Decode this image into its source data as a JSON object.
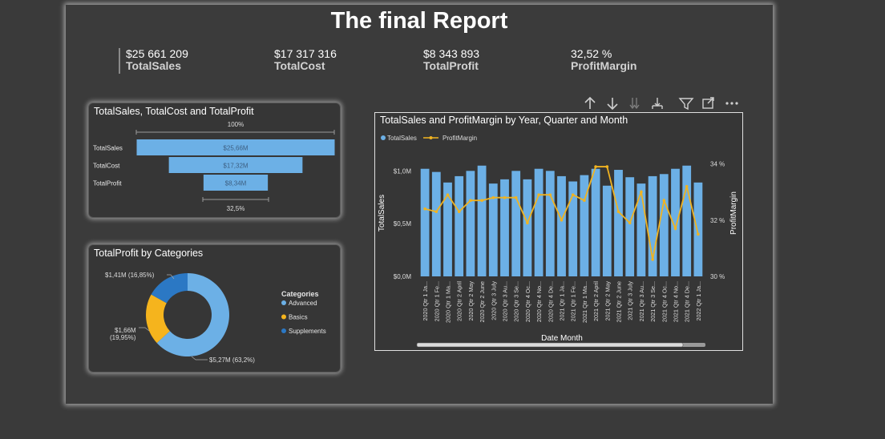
{
  "report": {
    "title": "The final Report"
  },
  "kpis": [
    {
      "value": "$25 661 209",
      "label": "TotalSales"
    },
    {
      "value": "$17 317 316",
      "label": "TotalCost"
    },
    {
      "value": "$8 343 893",
      "label": "TotalProfit"
    },
    {
      "value": "32,52 %",
      "label": "ProfitMargin"
    }
  ],
  "funnel": {
    "title": "TotalSales, TotalCost and TotalProfit",
    "top_label": "100%",
    "bottom_label": "32,5%",
    "rows": [
      {
        "label": "TotalSales",
        "value_label": "$25,66M"
      },
      {
        "label": "TotalCost",
        "value_label": "$17,32M"
      },
      {
        "label": "TotalProfit",
        "value_label": "$8,34M"
      }
    ]
  },
  "donut": {
    "title": "TotalProfit by Categories",
    "legend_title": "Categories",
    "slice_labels": [
      "$5,27M (63,2%)",
      "$1,66M",
      "(19,95%)",
      "$1,41M (16,85%)"
    ]
  },
  "combo": {
    "title": "TotalSales and ProfitMargin by Year, Quarter and Month",
    "x_title": "Date Month",
    "y_left_title": "TotalSales",
    "y_right_title": "ProfitMargin",
    "y_left_ticks": [
      "$1,0M",
      "$0,5M",
      "$0,0M"
    ],
    "y_right_ticks": [
      "34 %",
      "32 %",
      "30 %"
    ]
  },
  "colors": {
    "advanced": "#6cb0e6",
    "basics": "#f5b41d",
    "supplements": "#2b78c4",
    "line": "#f0b321"
  },
  "chart_data": [
    {
      "type": "bar",
      "title": "TotalSales, TotalCost and TotalProfit",
      "categories": [
        "TotalSales",
        "TotalCost",
        "TotalProfit"
      ],
      "values": [
        25.66,
        17.32,
        8.34
      ],
      "value_labels": [
        "$25,66M",
        "$17,32M",
        "$8,34M"
      ],
      "unit": "$M"
    },
    {
      "type": "pie",
      "title": "TotalProfit by Categories",
      "categories": [
        "Advanced",
        "Basics",
        "Supplements"
      ],
      "values": [
        5.27,
        1.66,
        1.41
      ],
      "percents": [
        63.2,
        19.95,
        16.85
      ]
    },
    {
      "type": "bar",
      "title": "TotalSales and ProfitMargin by Year, Quarter and Month",
      "xlabel": "Date Month",
      "ylabel": "TotalSales",
      "y2label": "ProfitMargin",
      "legend": [
        "TotalSales",
        "ProfitMargin"
      ],
      "ylim": [
        0,
        1.2
      ],
      "y2lim": [
        30,
        34.5
      ],
      "categories": [
        "2020 Qtr 1 Ja...",
        "2020 Qtr 1 Fe...",
        "2020 Qtr 1 Ma...",
        "2020 Qtr 2 April",
        "2020 Qtr 2 May",
        "2020 Qtr 2 June",
        "2020 Qtr 3 July",
        "2020 Qtr 3 Au...",
        "2020 Qtr 3 Se...",
        "2020 Qtr 4 Oc...",
        "2020 Qtr 4 No...",
        "2020 Qtr 4 De...",
        "2021 Qtr 1 Ja...",
        "2021 Qtr 1 Fe...",
        "2021 Qtr 1 Ma...",
        "2021 Qtr 2 April",
        "2021 Qtr 2 May",
        "2021 Qtr 2 June",
        "2021 Qtr 3 July",
        "2021 Qtr 3 Au...",
        "2021 Qtr 3 Se...",
        "2021 Qtr 4 Oc...",
        "2021 Qtr 4 No...",
        "2021 Qtr 4 De...",
        "2022 Qtr 1 Ja..."
      ],
      "series": [
        {
          "name": "TotalSales",
          "type": "bar",
          "values": [
            1.02,
            0.99,
            0.89,
            0.95,
            1.0,
            1.05,
            0.88,
            0.92,
            1.0,
            0.92,
            1.02,
            1.0,
            0.95,
            0.9,
            0.96,
            1.02,
            0.86,
            1.01,
            0.94,
            0.88,
            0.95,
            0.97,
            1.02,
            1.05,
            0.89
          ]
        },
        {
          "name": "ProfitMargin",
          "type": "line",
          "values": [
            32.4,
            32.3,
            32.9,
            32.3,
            32.7,
            32.7,
            32.8,
            32.8,
            32.8,
            31.9,
            32.9,
            32.9,
            32.0,
            32.9,
            32.7,
            33.9,
            33.9,
            32.3,
            31.9,
            33.0,
            30.6,
            32.7,
            31.7,
            33.2,
            31.5
          ]
        }
      ]
    }
  ]
}
